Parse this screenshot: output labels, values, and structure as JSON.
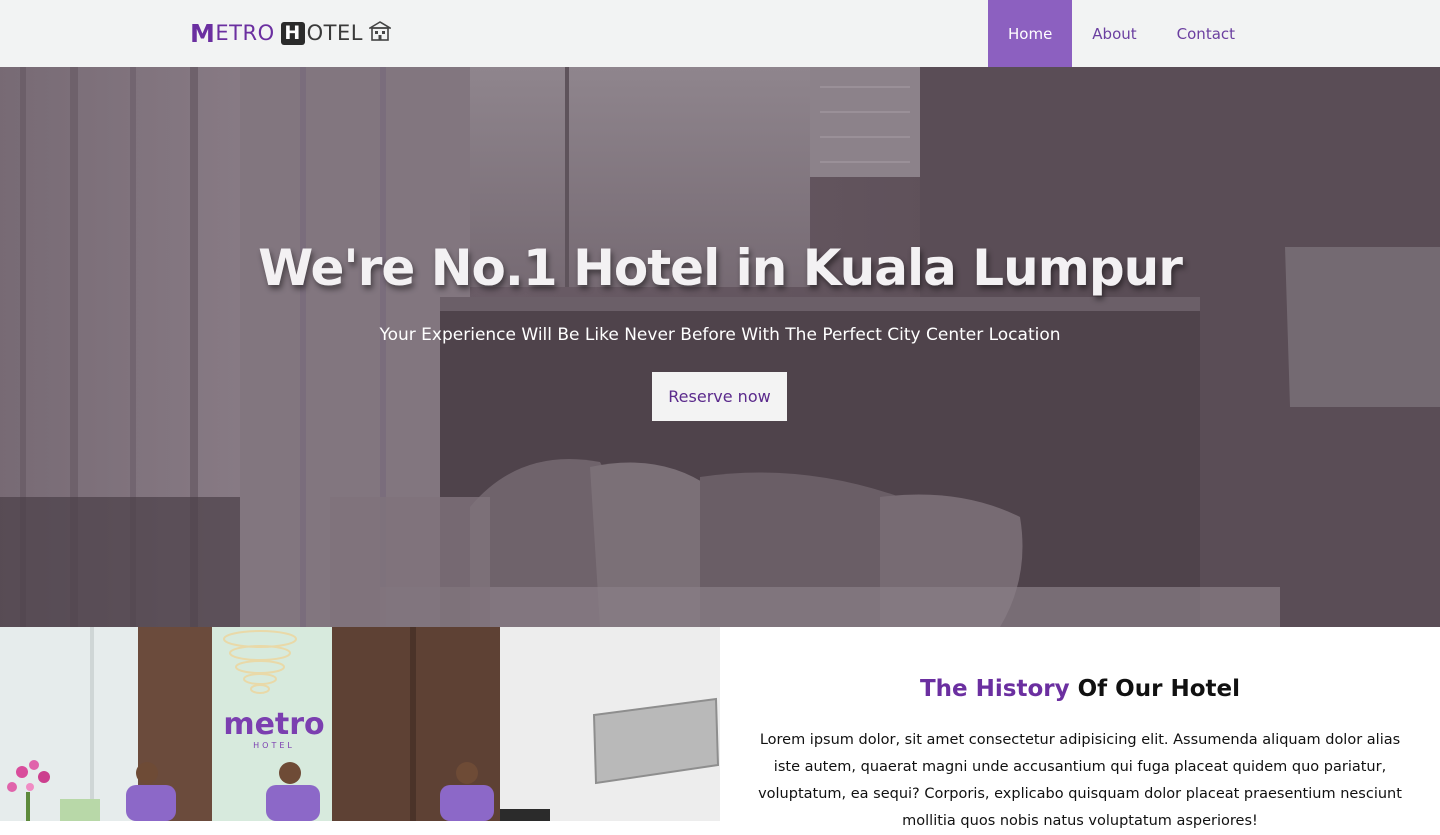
{
  "brand": {
    "first_letter": "M",
    "first_rest": "ETRO",
    "second_letter": "H",
    "second_rest": "OTEL",
    "icon": "hotel-building-icon",
    "colors": {
      "purple": "#6b2fa0",
      "dark": "#2b2b2b"
    }
  },
  "nav": {
    "items": [
      {
        "label": "Home",
        "active": true
      },
      {
        "label": "About",
        "active": false
      },
      {
        "label": "Contact",
        "active": false
      }
    ],
    "active_color": "#8c60c0",
    "link_color": "#6b3fa0",
    "background": "#f2f3f3"
  },
  "hero": {
    "title": "We're No.1 Hotel in Kuala Lumpur",
    "subtitle": "Your Experience Will Be Like Never Before With The Perfect City Center Location",
    "button": "Reserve now"
  },
  "lobby": {
    "sign_text": "metro",
    "sign_sub": "HOTEL"
  },
  "history": {
    "title_highlight": "The History",
    "title_rest": " Of Our Hotel",
    "text": "Lorem ipsum dolor, sit amet consectetur adipisicing elit. Assumenda aliquam dolor alias iste autem, quaerat magni unde accusantium qui fuga placeat quidem quo pariatur, voluptatum, ea sequi? Corporis, explicabo quisquam dolor placeat praesentium nesciunt mollitia quos nobis natus voluptatum asperiores!"
  }
}
